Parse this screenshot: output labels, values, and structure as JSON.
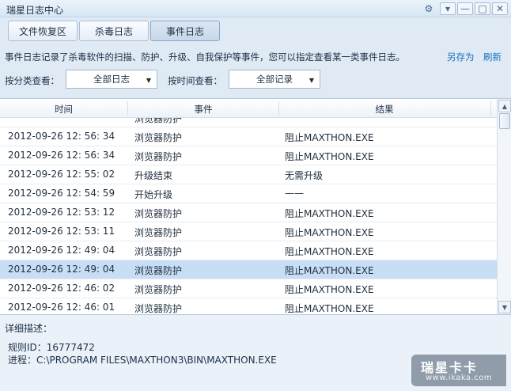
{
  "window": {
    "title": "瑞星日志中心",
    "controls": [
      {
        "name": "settings-gear-icon",
        "glyph": "⚙"
      },
      {
        "name": "menu-dropdown-icon",
        "glyph": "▾"
      },
      {
        "name": "minimize-icon",
        "glyph": "—"
      },
      {
        "name": "maximize-icon",
        "glyph": "□"
      },
      {
        "name": "close-icon",
        "glyph": "✕"
      }
    ]
  },
  "tabs": [
    {
      "label": "文件恢复区",
      "active": false
    },
    {
      "label": "杀毒日志",
      "active": false
    },
    {
      "label": "事件日志",
      "active": true
    }
  ],
  "description": {
    "text": "事件日志记录了杀毒软件的扫描、防护、升级、自我保护等事件，您可以指定查看某一类事件日志。",
    "save_as": "另存为",
    "refresh": "刷新"
  },
  "filters": {
    "category_label": "按分类查看：",
    "category_value": "全部日志",
    "time_label": "按时间查看：",
    "time_value": "全部记录"
  },
  "table": {
    "columns": [
      "时间",
      "事件",
      "结果"
    ],
    "partial_row": {
      "time": "",
      "event": "浏览器防护",
      "result": ""
    },
    "rows": [
      {
        "time": "2012-09-26 12: 56: 34",
        "event": "浏览器防护",
        "result": "阻止MAXTHON.EXE"
      },
      {
        "time": "2012-09-26 12: 56: 34",
        "event": "浏览器防护",
        "result": "阻止MAXTHON.EXE"
      },
      {
        "time": "2012-09-26 12: 55: 02",
        "event": "升级结束",
        "result": "无需升级"
      },
      {
        "time": "2012-09-26 12: 54: 59",
        "event": "开始升级",
        "result": "——"
      },
      {
        "time": "2012-09-26 12: 53: 12",
        "event": "浏览器防护",
        "result": "阻止MAXTHON.EXE"
      },
      {
        "time": "2012-09-26 12: 53: 11",
        "event": "浏览器防护",
        "result": "阻止MAXTHON.EXE"
      },
      {
        "time": "2012-09-26 12: 49: 04",
        "event": "浏览器防护",
        "result": "阻止MAXTHON.EXE"
      },
      {
        "time": "2012-09-26 12: 49: 04",
        "event": "浏览器防护",
        "result": "阻止MAXTHON.EXE",
        "selected": true
      },
      {
        "time": "2012-09-26 12: 46: 02",
        "event": "浏览器防护",
        "result": "阻止MAXTHON.EXE"
      },
      {
        "time": "2012-09-26 12: 46: 01",
        "event": "浏览器防护",
        "result": "阻止MAXTHON.EXE"
      }
    ]
  },
  "detail": {
    "title": "详细描述：",
    "rule_id": "规则ID：16777472",
    "process": "进程：C:\\PROGRAM FILES\\MAXTHON3\\BIN\\MAXTHON.EXE"
  },
  "watermark": {
    "logo_text": "瑞星卡卡",
    "url": "www.ikaka.com"
  },
  "colors": {
    "link": "#1a6fbf",
    "selected_row": "#c8def4",
    "background": "#dfeaf5"
  }
}
